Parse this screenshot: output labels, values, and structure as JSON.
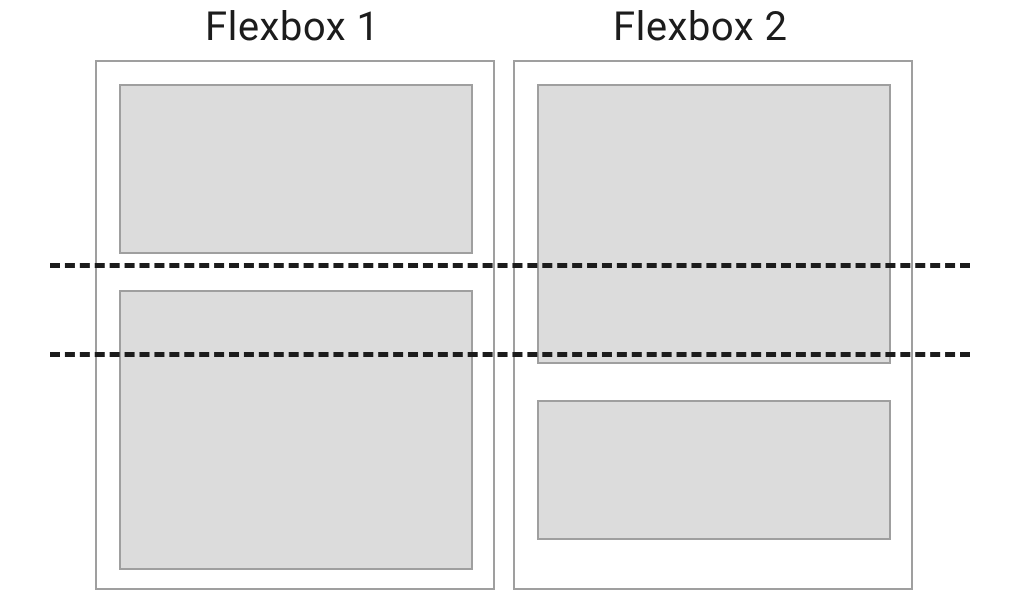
{
  "diagram": {
    "title_left": "Flexbox 1",
    "title_right": "Flexbox 2",
    "colors": {
      "box_fill": "#dcdcdc",
      "box_border": "#9f9f9f",
      "dash": "#1c1c1c",
      "text": "#1c1c1c"
    },
    "description": "Two side-by-side flex containers each holding two stacked child boxes of differing heights. Two horizontal dashed guide lines span the full width passing through both containers, illustrating that the child boxes in the two containers do not align to common row tracks."
  }
}
